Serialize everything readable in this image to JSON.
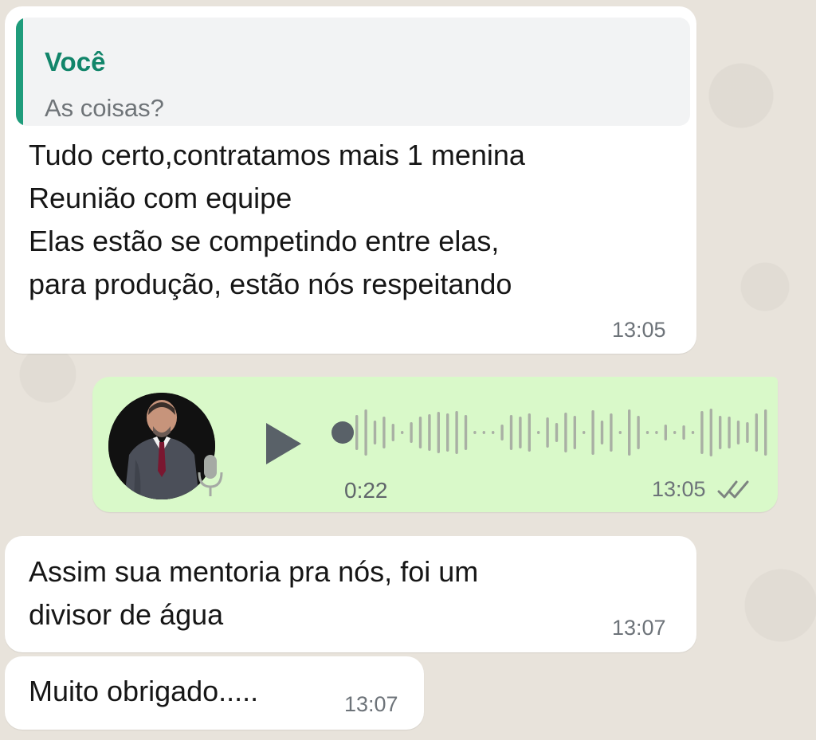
{
  "chat": {
    "messages": [
      {
        "type": "text",
        "direction": "incoming",
        "quote": {
          "author": "Você",
          "text": "As coisas?"
        },
        "text": "Tudo certo,contratamos mais 1 menina\nReunião com equipe\nElas estão se competindo entre elas,\npara produção, estão nós respeitando",
        "time": "13:05"
      },
      {
        "type": "voice",
        "direction": "outgoing",
        "duration": "0:22",
        "time": "13:05",
        "playback_progress": 0,
        "status": "double-check-icon"
      },
      {
        "type": "text",
        "direction": "incoming",
        "text": "Assim sua mentoria pra nós, foi um\ndivisor de água",
        "time": "13:07"
      },
      {
        "type": "text",
        "direction": "incoming",
        "text": "Muito obrigado.....",
        "time": "13:07"
      }
    ]
  },
  "colors": {
    "incoming_bubble": "#ffffff",
    "outgoing_bubble": "#d9f9c9",
    "quote_accent": "#1f9c7b",
    "wallpaper": "#e8e3db"
  }
}
